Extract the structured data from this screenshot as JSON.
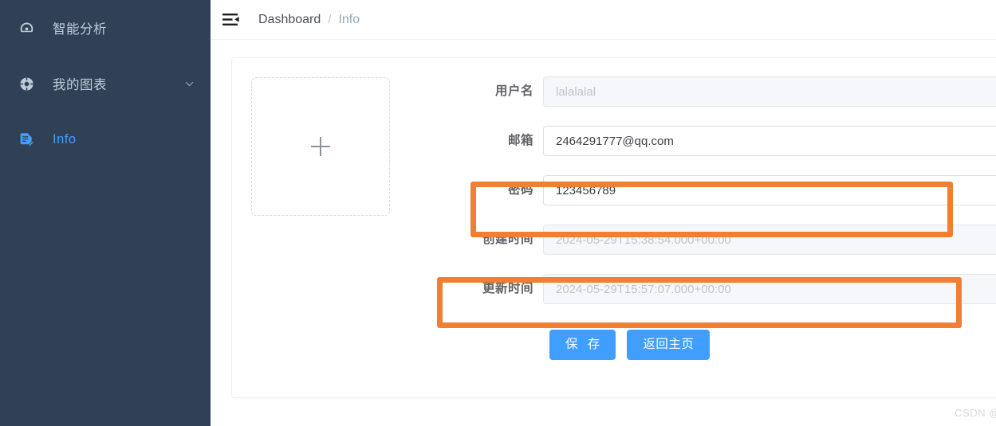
{
  "sidebar": {
    "background_color": "#304156",
    "active_color": "#409eff",
    "items": [
      {
        "label": "智能分析",
        "icon": "dashboard-gauge-icon",
        "active": false,
        "has_chevron": false
      },
      {
        "label": "我的图表",
        "icon": "pie-chart-icon",
        "active": false,
        "has_chevron": true,
        "chevron_icon": "chevron-down-icon"
      },
      {
        "label": "Info",
        "icon": "document-edit-icon",
        "active": true,
        "has_chevron": false
      }
    ]
  },
  "navbar": {
    "menu_toggle_icon": "hamburger-collapse-icon",
    "breadcrumb": {
      "root": "Dashboard",
      "separator": "/",
      "current": "Info"
    }
  },
  "card": {
    "avatar_upload": {
      "icon": "plus-icon",
      "label": ""
    },
    "form": {
      "fields": [
        {
          "label": "用户名",
          "name": "username",
          "value": "",
          "placeholder": "lalalalal",
          "disabled": true
        },
        {
          "label": "邮箱",
          "name": "email",
          "value": "2464291777@qq.com",
          "placeholder": "",
          "disabled": false
        },
        {
          "label": "密码",
          "name": "password",
          "value": "123456789",
          "placeholder": "",
          "disabled": false
        },
        {
          "label": "创建时间",
          "name": "create-time",
          "value": "",
          "placeholder": "2024-05-29T15:38:54.000+00:00",
          "disabled": true
        },
        {
          "label": "更新时间",
          "name": "update-time",
          "value": "",
          "placeholder": "2024-05-29T15:57:07.000+00:00",
          "disabled": true
        }
      ],
      "buttons": [
        {
          "label": "保 存",
          "name": "save-button"
        },
        {
          "label": "返回主页",
          "name": "back-home-button"
        }
      ]
    }
  },
  "annotations": {
    "color": "#ef8033",
    "boxes": [
      {
        "target": "password-field"
      },
      {
        "target": "update-time-field"
      }
    ]
  },
  "watermark": {
    "text": "CSDN @南暖xi"
  }
}
